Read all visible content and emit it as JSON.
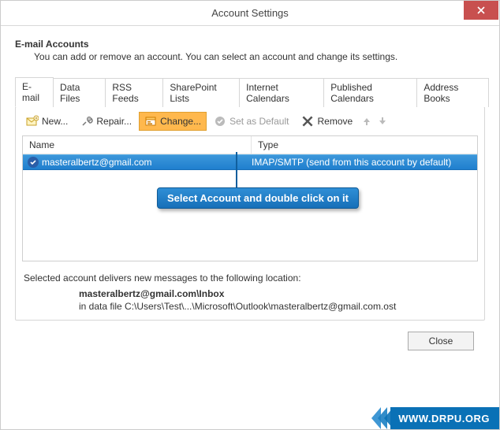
{
  "window": {
    "title": "Account Settings"
  },
  "header": {
    "heading": "E-mail Accounts",
    "subheading": "You can add or remove an account. You can select an account and change its settings."
  },
  "tabs": [
    {
      "label": "E-mail",
      "active": true
    },
    {
      "label": "Data Files"
    },
    {
      "label": "RSS Feeds"
    },
    {
      "label": "SharePoint Lists"
    },
    {
      "label": "Internet Calendars"
    },
    {
      "label": "Published Calendars"
    },
    {
      "label": "Address Books"
    }
  ],
  "toolbar": {
    "new_label": "New...",
    "repair_label": "Repair...",
    "change_label": "Change...",
    "default_label": "Set as Default",
    "remove_label": "Remove"
  },
  "list": {
    "columns": {
      "name": "Name",
      "type": "Type"
    },
    "rows": [
      {
        "name": "masteralbertz@gmail.com",
        "type": "IMAP/SMTP (send from this account by default)",
        "selected": true
      }
    ]
  },
  "callout": "Select Account and double click on it",
  "delivery": {
    "intro": "Selected account delivers new messages to the following location:",
    "bold": "masteralbertz@gmail.com\\Inbox",
    "path": "in data file C:\\Users\\Test\\...\\Microsoft\\Outlook\\masteralbertz@gmail.com.ost"
  },
  "buttons": {
    "close": "Close"
  },
  "branding": "WWW.DRPU.ORG"
}
